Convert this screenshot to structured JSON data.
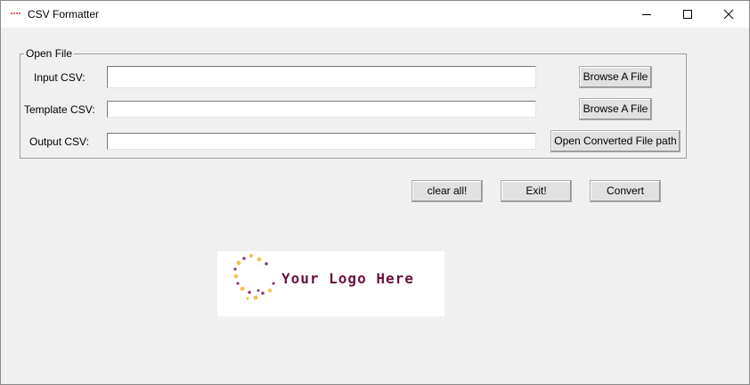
{
  "window": {
    "title": "CSV Formatter"
  },
  "open_file": {
    "legend": "Open File",
    "input_label": "Input CSV:",
    "input_value": "",
    "template_label": "Template CSV:",
    "template_value": "",
    "output_label": "Output CSV:",
    "output_value": "",
    "browse_input_label": "Browse A File",
    "browse_template_label": "Browse A File",
    "open_output_label": "Open Converted File path"
  },
  "actions": {
    "clear_label": "clear all!",
    "exit_label": "Exit!",
    "convert_label": "Convert"
  },
  "logo": {
    "text": "Your Logo Here",
    "colors": {
      "text": "#6b1240",
      "dot_primary": "#f2c14e",
      "dot_secondary": "#8e3b77"
    }
  }
}
